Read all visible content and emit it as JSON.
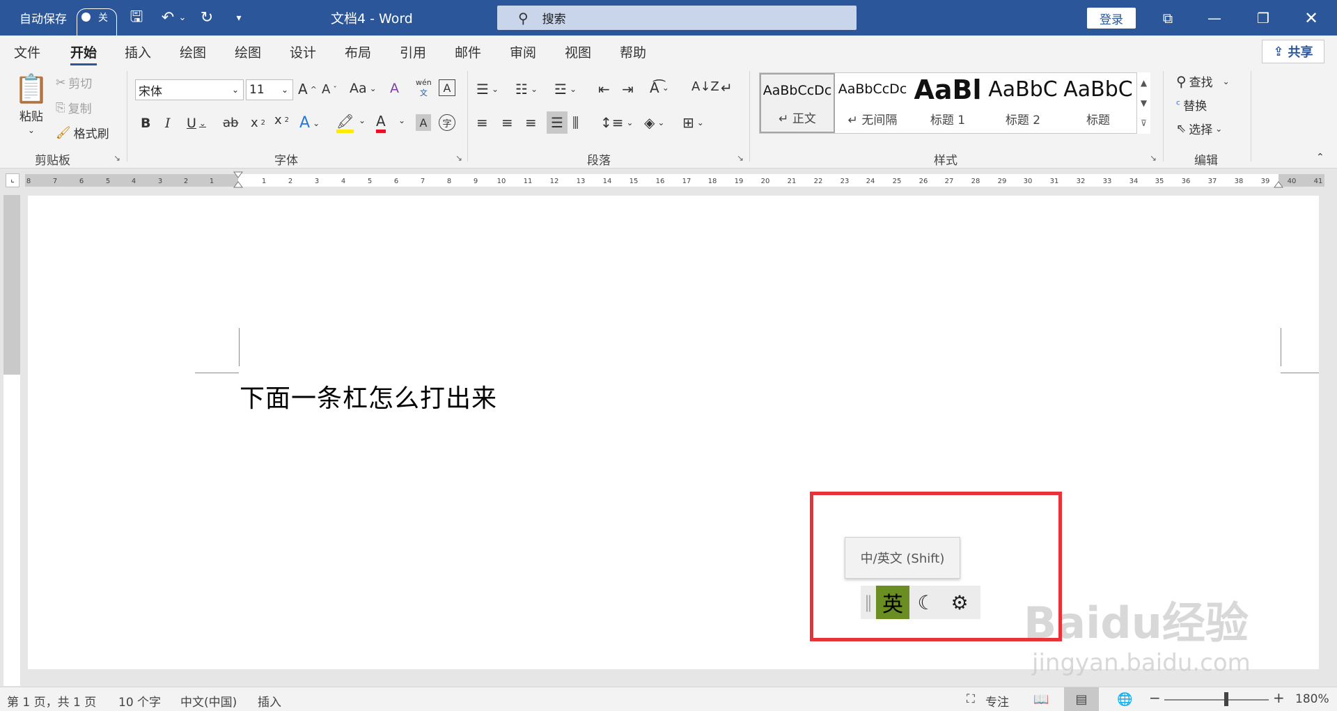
{
  "titlebar": {
    "autosave_label": "自动保存",
    "autosave_state": "关",
    "doc_title": "文档4  -  Word",
    "search_placeholder": "搜索",
    "login_label": "登录"
  },
  "tabs": [
    "文件",
    "开始",
    "插入",
    "绘图",
    "绘图",
    "设计",
    "布局",
    "引用",
    "邮件",
    "审阅",
    "视图",
    "帮助"
  ],
  "active_tab": "开始",
  "share_label": "共享",
  "clipboard": {
    "paste": "粘贴",
    "cut": "剪切",
    "copy": "复制",
    "format_painter": "格式刷",
    "label": "剪贴板"
  },
  "font": {
    "name": "宋体",
    "size": "11",
    "label": "字体"
  },
  "paragraph": {
    "label": "段落"
  },
  "styles": {
    "label": "样式",
    "items": [
      {
        "sample": "AaBbCcDc",
        "name": "↵ 正文"
      },
      {
        "sample": "AaBbCcDc",
        "name": "↵ 无间隔"
      },
      {
        "sample": "AaBl",
        "name": "标题 1"
      },
      {
        "sample": "AaBbC",
        "name": "标题 2"
      },
      {
        "sample": "AaBbC",
        "name": "标题"
      }
    ]
  },
  "editing": {
    "find": "查找",
    "replace": "替换",
    "select": "选择",
    "label": "编辑"
  },
  "document": {
    "text": "下面一条杠怎么打出来"
  },
  "ime": {
    "tooltip": "中/英文 (Shift)",
    "lang": "英"
  },
  "statusbar": {
    "page": "第 1 页，共 1 页",
    "words": "10 个字",
    "language": "中文(中国)",
    "mode": "插入",
    "focus": "专注",
    "zoom": "180%"
  },
  "watermark": {
    "logo": "Baidu经验",
    "url": "jingyan.baidu.com"
  },
  "colors": {
    "accent": "#2b579a",
    "highlight_box": "#e8323a",
    "ime_active": "#6b8e23"
  }
}
